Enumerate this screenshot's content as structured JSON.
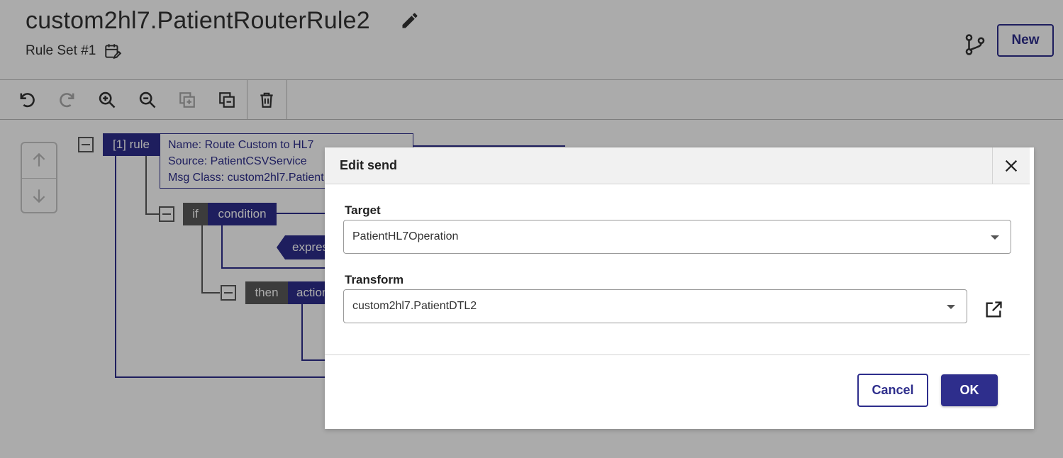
{
  "header": {
    "title": "custom2hl7.PatientRouterRule2",
    "subtitle": "Rule Set #1",
    "new_label": "New"
  },
  "toolbar": {
    "buttons": [
      "undo-icon",
      "redo-icon",
      "zoom-in-icon",
      "zoom-out-icon",
      "copy-icon",
      "paste-icon",
      "delete-icon"
    ]
  },
  "tree": {
    "rule_label": "[1] rule",
    "info_lines": [
      "Name: Route Custom to HL7",
      "Source: PatientCSVService",
      "Msg Class: custom2hl7.Patient"
    ],
    "if_label": "if",
    "condition_label": "condition",
    "expression_label": "express",
    "then_label": "then",
    "action_label": "action"
  },
  "modal": {
    "title": "Edit send",
    "target_label": "Target",
    "target_value": "PatientHL7Operation",
    "transform_label": "Transform",
    "transform_value": "custom2hl7.PatientDTL2",
    "cancel_label": "Cancel",
    "ok_label": "OK"
  },
  "colors": {
    "accent": "#2e2e8c",
    "node_gray": "#5a5a5a",
    "overlay": "rgba(0,0,0,0.33)"
  }
}
